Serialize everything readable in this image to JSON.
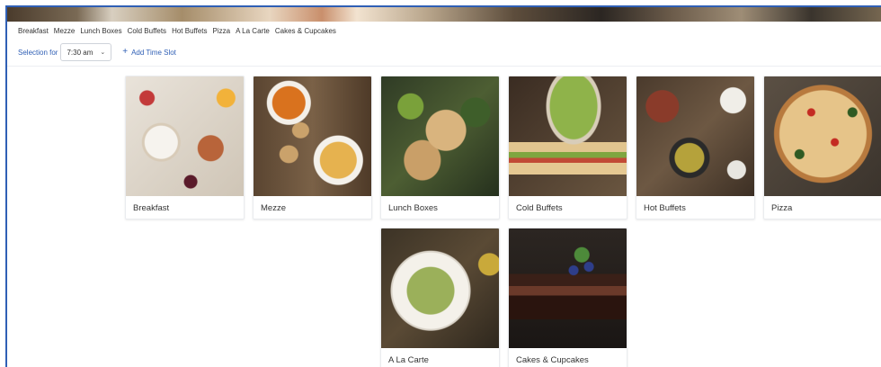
{
  "categories_nav": [
    "Breakfast",
    "Mezze",
    "Lunch Boxes",
    "Cold Buffets",
    "Hot Buffets",
    "Pizza",
    "A La Carte",
    "Cakes & Cupcakes"
  ],
  "selection": {
    "label": "Selection for",
    "time_value": "7:30 am",
    "add_slot_label": "Add Time Slot"
  },
  "cards": [
    {
      "label": "Breakfast"
    },
    {
      "label": "Mezze"
    },
    {
      "label": "Lunch Boxes"
    },
    {
      "label": "Cold Buffets"
    },
    {
      "label": "Hot Buffets"
    },
    {
      "label": "Pizza"
    },
    {
      "label": "A La Carte"
    },
    {
      "label": "Cakes & Cupcakes"
    }
  ],
  "colors": {
    "accent": "#2f5fb5",
    "text": "#333333",
    "border": "#cfd3da"
  },
  "icons": {
    "time_dropdown": "chevron-down-icon",
    "add_slot": "plus-icon"
  }
}
